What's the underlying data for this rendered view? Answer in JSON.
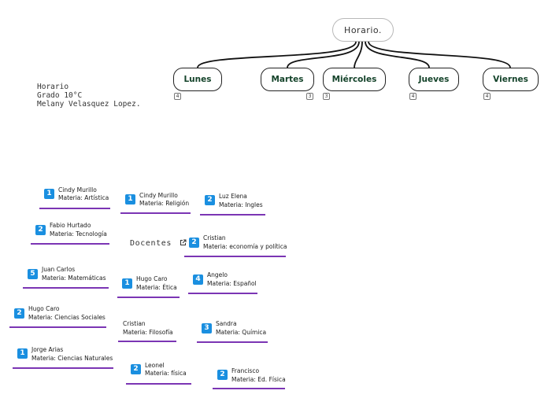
{
  "root": {
    "label": "Horario."
  },
  "days": [
    {
      "label": "Lunes",
      "count": "4"
    },
    {
      "label": "Martes",
      "count": "3"
    },
    {
      "label": "Miércoles",
      "count": "3"
    },
    {
      "label": "Jueves",
      "count": "4"
    },
    {
      "label": "Viernes",
      "count": "4"
    }
  ],
  "note": "Horario\nGrado 10°C\nMelany Velasquez Lopez.",
  "docentes": {
    "label": "Docentes"
  },
  "cards": [
    {
      "badge": "1",
      "name": "Cindy Murillo",
      "subject": "Materia: Artística"
    },
    {
      "badge": "1",
      "name": "Cindy Murillo",
      "subject": "Materia: Religión"
    },
    {
      "badge": "2",
      "name": "Luz Elena",
      "subject": "Materia: Ingles"
    },
    {
      "badge": "2",
      "name": "Fabio Hurtado",
      "subject": "Materia: Tecnología"
    },
    {
      "badge": "2",
      "name": "Cristian",
      "subject": "Materia: economía y política"
    },
    {
      "badge": "5",
      "name": "Juan Carlos",
      "subject": "Materia: Matemáticas"
    },
    {
      "badge": "1",
      "name": "Hugo Caro",
      "subject": "Materia: Ética"
    },
    {
      "badge": "4",
      "name": "Angelo",
      "subject": "Materia: Español"
    },
    {
      "badge": "2",
      "name": "Hugo Caro",
      "subject": "Materia: Ciencias Sociales"
    },
    {
      "badge": "",
      "name": "Cristian",
      "subject": "Materia: Filosofía"
    },
    {
      "badge": "3",
      "name": "Sandra",
      "subject": "Materia: Química"
    },
    {
      "badge": "1",
      "name": "Jorge Arias",
      "subject": "Materia: Ciencias Naturales"
    },
    {
      "badge": "2",
      "name": "Leonel",
      "subject": "Materia: física"
    },
    {
      "badge": "2",
      "name": "Francisco",
      "subject": "Materia: Ed. Física"
    }
  ]
}
